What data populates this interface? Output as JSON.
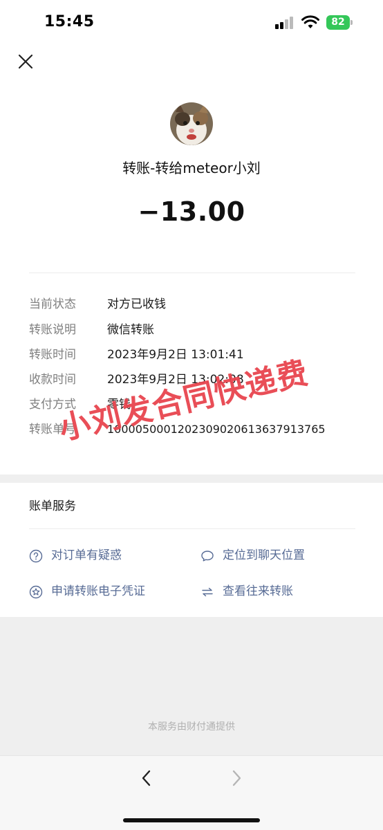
{
  "status_bar": {
    "time": "15:45",
    "battery": "82"
  },
  "header": {
    "title": "转账-转给meteor小刘",
    "amount": "−13.00"
  },
  "details": [
    {
      "label": "当前状态",
      "value": "对方已收钱"
    },
    {
      "label": "转账说明",
      "value": "微信转账"
    },
    {
      "label": "转账时间",
      "value": "2023年9月2日 13:01:41"
    },
    {
      "label": "收款时间",
      "value": "2023年9月2日 13:02:08"
    },
    {
      "label": "支付方式",
      "value": "零钱"
    },
    {
      "label": "转账单号",
      "value": "1000050001202309020613637913765"
    }
  ],
  "services": {
    "title": "账单服务",
    "items": [
      {
        "label": "对订单有疑惑",
        "icon": "question-circle-icon"
      },
      {
        "label": "定位到聊天位置",
        "icon": "chat-bubble-icon"
      },
      {
        "label": "申请转账电子凭证",
        "icon": "star-badge-icon"
      },
      {
        "label": "查看往来转账",
        "icon": "swap-arrows-icon"
      }
    ]
  },
  "footer": {
    "note": "本服务由财付通提供"
  },
  "watermark": {
    "text": "小刘发合同快递费"
  },
  "colors": {
    "link": "#576b95",
    "watermark": "#e8454f",
    "battery": "#34c759"
  }
}
